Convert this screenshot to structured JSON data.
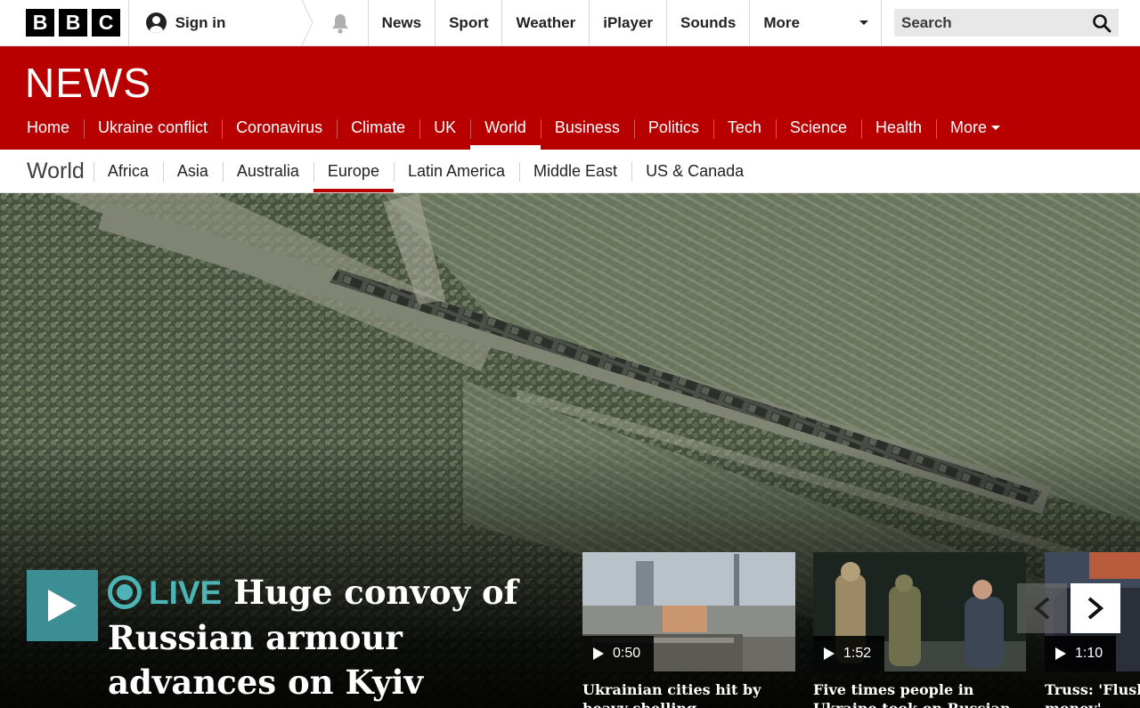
{
  "global_nav": {
    "logo_letters": [
      "B",
      "B",
      "C"
    ],
    "sign_in_label": "Sign in",
    "items": [
      "News",
      "Sport",
      "Weather",
      "iPlayer",
      "Sounds"
    ],
    "more_label": "More",
    "search_placeholder": "Search"
  },
  "news_banner": {
    "wordmark": "NEWS",
    "nav": [
      "Home",
      "Ukraine conflict",
      "Coronavirus",
      "Climate",
      "UK",
      "World",
      "Business",
      "Politics",
      "Tech",
      "Science",
      "Health"
    ],
    "active": "World",
    "more_label": "More"
  },
  "section_nav": {
    "title": "World",
    "items": [
      "Africa",
      "Asia",
      "Australia",
      "Europe",
      "Latin America",
      "Middle East",
      "US & Canada"
    ],
    "active": "Europe"
  },
  "hero": {
    "live_label": "LIVE",
    "headline": "Huge convoy of Russian armour advances on Kyiv"
  },
  "videos": [
    {
      "duration": "0:50",
      "title": "Ukrainian cities hit by heavy shelling"
    },
    {
      "duration": "1:52",
      "title": "Five times people in Ukraine took on Russian forces"
    },
    {
      "duration": "1:10",
      "title": "Truss: 'Flush out dirty money'"
    }
  ],
  "colors": {
    "bbc_red": "#b80000",
    "live_teal": "#4db4b6",
    "play_tile": "#3b8f94"
  },
  "icons": {
    "bell": "bell-icon",
    "search": "search-icon",
    "avatar": "user-icon",
    "play": "play-icon",
    "prev": "chevron-left-icon",
    "next": "chevron-right-icon"
  }
}
